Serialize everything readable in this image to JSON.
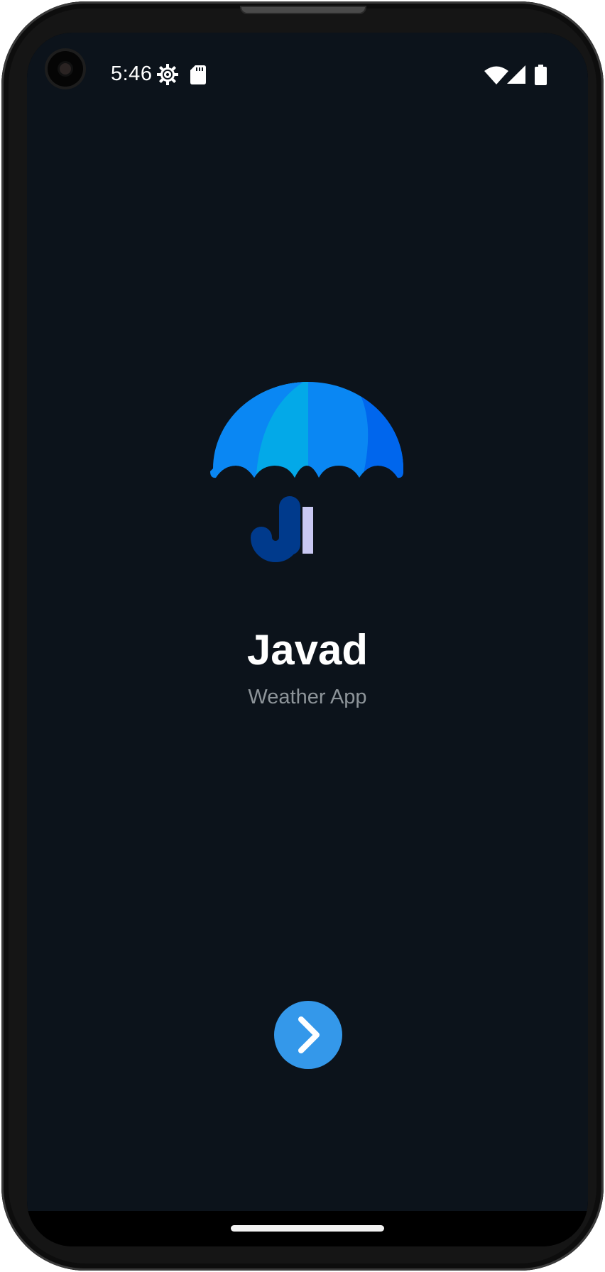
{
  "status_bar": {
    "time": "5:46",
    "icons": [
      "settings-gear-icon",
      "sd-card-icon",
      "wifi-icon",
      "cell-signal-icon",
      "battery-icon"
    ]
  },
  "splash": {
    "logo_icon": "umbrella-icon",
    "title": "Javad",
    "subtitle": "Weather App"
  },
  "next_button": {
    "icon": "chevron-right-icon",
    "color": "#3498ea"
  },
  "colors": {
    "background": "#0c131b",
    "title": "#ffffff",
    "subtitle": "#8d9499",
    "umbrella_left": "#0a87f3",
    "umbrella_mid": "#03a9e8",
    "umbrella_right": "#0066ed",
    "umbrella_handle": "#003a8c"
  }
}
